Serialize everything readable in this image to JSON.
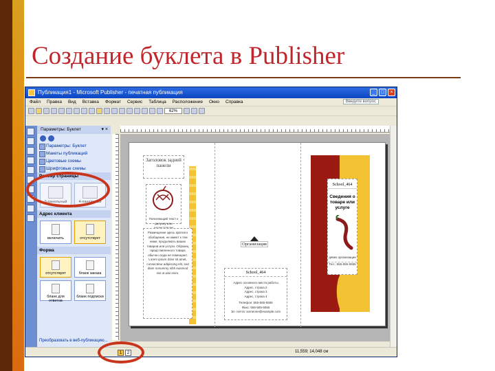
{
  "slide": {
    "title": "Создание буклета в Publisher"
  },
  "window": {
    "title": "Публикация1 - Microsoft Publisher - печатная публикация",
    "controls": [
      "_",
      "□",
      "×"
    ],
    "menu": [
      "Файл",
      "Правка",
      "Вид",
      "Вставка",
      "Формат",
      "Сервис",
      "Таблица",
      "Расположение",
      "Окно",
      "Справка"
    ],
    "help_placeholder": "Введите вопрос",
    "zoom": "62%"
  },
  "task_pane": {
    "title": "Параметры: Буклет",
    "links": [
      "Параметры: Буклет",
      "Макеты публикаций",
      "Цветовые схемы",
      "Шрифтовые схемы"
    ],
    "page_size_label": "Размер страницы",
    "page_size_options": [
      "3-панельный",
      "4-панельный"
    ],
    "address_label": "Адрес клиента",
    "address_options": [
      "включить",
      "отсутствует"
    ],
    "form_label": "Форма",
    "form_options": [
      "отсутствует",
      "бланк заказа",
      "бланк для ответов",
      "бланк подписки"
    ],
    "convert_link": "Преобразовать в веб-публикацию..."
  },
  "booklet": {
    "back_title": "Заголовок задней панели",
    "back_caption": "Поясняющий текст к рисунку или иллюстрации",
    "back_body": "Размещение здесь краткого обобщения, не имеет к тем ниже, продолжать ваших товаров или услуги. Образец представленного товара обычно сюда не помещают. Lorem ipsum dolor sit amet, consectetur adipiscing elit, sed diam nonummy nibh euismod nisi ut wisi enim.",
    "org_label": "Организация",
    "address_title": "School_464",
    "address_lines": [
      "Адрес основного места работы",
      "Адрес, строка 2",
      "Адрес, строка 3",
      "Адрес, строка 4"
    ],
    "phone_lines": [
      "Телефон: 555-555-5555",
      "Факс: 555-555-5555",
      "Эл. почта: someone@example.com"
    ],
    "cover_org": "School_464",
    "cover_title": "Сведения о товаре или услуге",
    "cover_caption": "девиз организации",
    "cover_phone": "Тел.: 555-555-5555"
  },
  "status": {
    "pages": [
      "1",
      "2"
    ],
    "coords": "11,559; 14,048 см"
  },
  "colors": {
    "accent": "#c0272d",
    "cover_red": "#9b1b12",
    "cover_yellow": "#f2c232",
    "highlight": "#c9341c"
  }
}
